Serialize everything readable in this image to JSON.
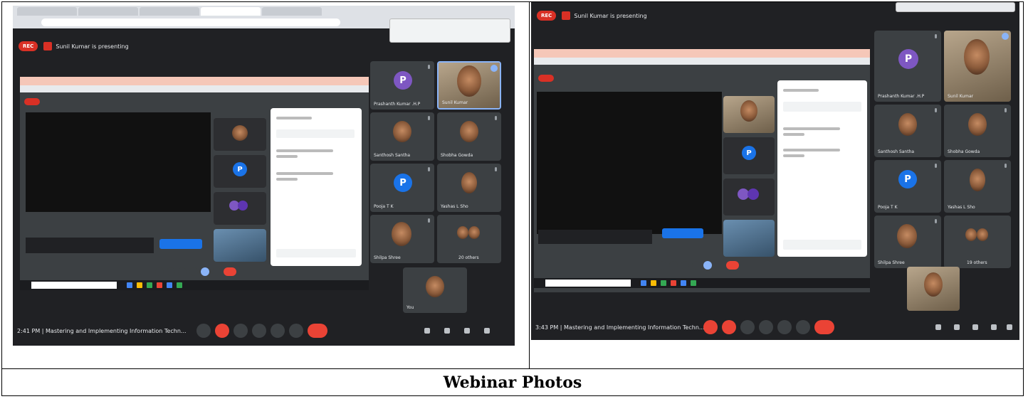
{
  "caption": "Webinar Photos",
  "shots": [
    {
      "rec_label": "REC",
      "presenter_label": "Sunil Kumar is presenting",
      "tiles": [
        {
          "name": "Prashanth Kumar .H.P",
          "type": "avatar",
          "initial": "P",
          "color": "#7e57c2"
        },
        {
          "name": "Sunil Kumar",
          "type": "video"
        },
        {
          "name": "Santhosh Santha",
          "type": "face"
        },
        {
          "name": "Shobha Gowda",
          "type": "face"
        },
        {
          "name": "Pooja T K",
          "type": "avatar",
          "initial": "P",
          "color": "#1a73e8"
        },
        {
          "name": "Yashas L Sho",
          "type": "face"
        },
        {
          "name": "Shilpa Shree",
          "type": "face"
        },
        {
          "name": "20 others",
          "type": "group"
        },
        {
          "name": "You",
          "type": "face"
        }
      ],
      "meeting_info": "2:41 PM  |  Mastering and Implementing Information Techn..."
    },
    {
      "rec_label": "REC",
      "presenter_label": "Sunil Kumar is presenting",
      "tiles": [
        {
          "name": "Prashanth Kumar .H.P",
          "type": "avatar",
          "initial": "P",
          "color": "#7e57c2"
        },
        {
          "name": "Sunil Kumar",
          "type": "video"
        },
        {
          "name": "Santhosh Santha",
          "type": "face"
        },
        {
          "name": "Shobha Gowda",
          "type": "face"
        },
        {
          "name": "Pooja T K",
          "type": "avatar",
          "initial": "P",
          "color": "#1a73e8"
        },
        {
          "name": "Yashas L Sho",
          "type": "face"
        },
        {
          "name": "Shilpa Shree",
          "type": "face"
        },
        {
          "name": "19 others",
          "type": "group"
        }
      ],
      "meeting_info": "3:43 PM  |  Mastering and Implementing Information Techn..."
    }
  ]
}
